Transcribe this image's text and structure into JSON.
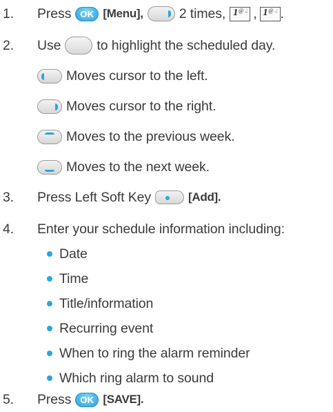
{
  "steps": [
    {
      "number": "1.",
      "press": "Press",
      "ok_label": "OK",
      "menu_label": "[Menu],",
      "times_text": "2 times,",
      "key_glyph": "1",
      "key_sub": "@ .:",
      "comma": ","
    },
    {
      "number": "2.",
      "use": "Use",
      "after_nav": "to highlight the scheduled day.",
      "nav_items": [
        {
          "icon": "nav-left-icon",
          "text": "Moves cursor to the left."
        },
        {
          "icon": "nav-right-icon",
          "text": "Moves cursor to the right."
        },
        {
          "icon": "nav-up-icon",
          "text": "Moves to the previous week."
        },
        {
          "icon": "nav-down-icon",
          "text": "Moves to the next week."
        }
      ]
    },
    {
      "number": "3.",
      "text": "Press Left Soft Key",
      "add_label": "[Add]."
    },
    {
      "number": "4.",
      "text": "Enter your schedule information including:",
      "bullets": [
        "Date",
        "Time",
        "Title/information",
        "Recurring event",
        "When to ring the alarm reminder",
        "Which ring alarm to sound"
      ]
    },
    {
      "number": "5.",
      "press": "Press",
      "ok_label": "OK",
      "save_label": "[SAVE]."
    }
  ],
  "colors": {
    "accent": "#2aa6de",
    "text": "#3a3a3a",
    "button_gray": "#d6d6d6"
  }
}
